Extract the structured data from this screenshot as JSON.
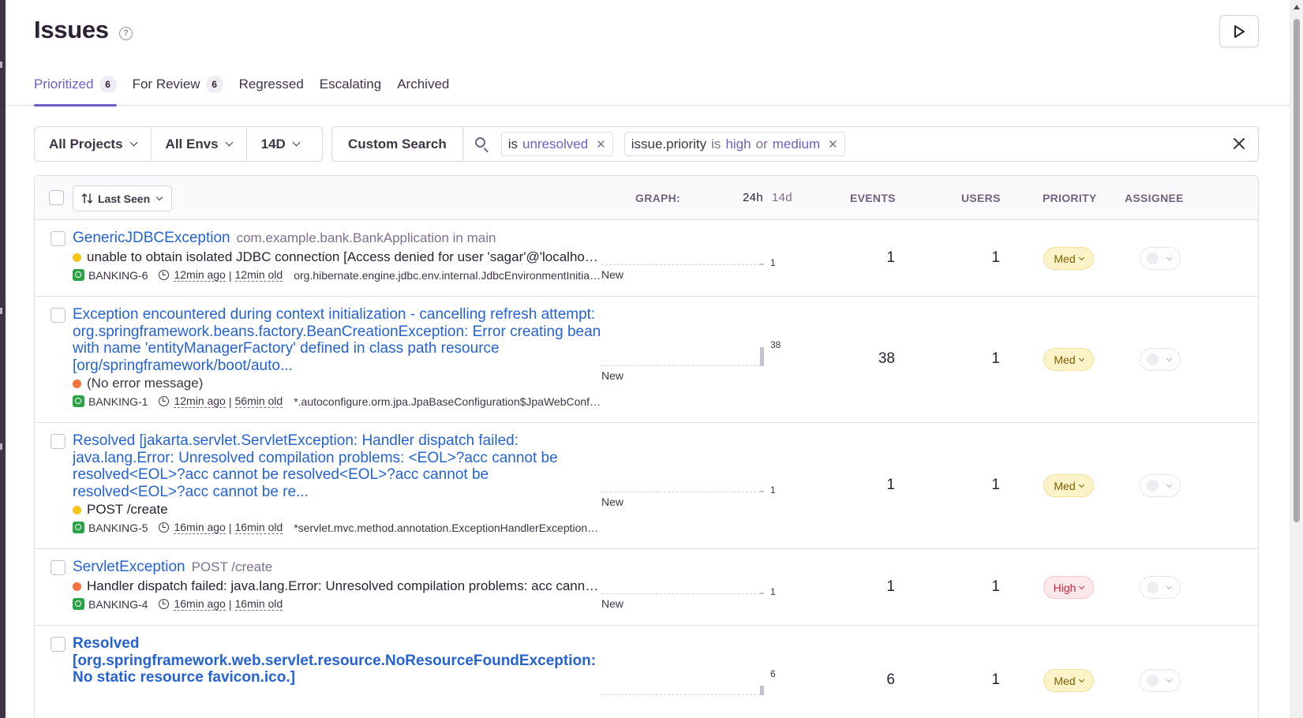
{
  "header": {
    "title": "Issues",
    "help_icon": "question-circle-icon",
    "play_icon": "play-icon"
  },
  "tabs": [
    {
      "label": "Prioritized",
      "count": "6",
      "active": true
    },
    {
      "label": "For Review",
      "count": "6",
      "active": false
    },
    {
      "label": "Regressed",
      "count": null,
      "active": false
    },
    {
      "label": "Escalating",
      "count": null,
      "active": false
    },
    {
      "label": "Archived",
      "count": null,
      "active": false
    }
  ],
  "filters": {
    "projects": "All Projects",
    "envs": "All Envs",
    "period": "14D"
  },
  "search": {
    "custom_search_label": "Custom Search",
    "tokens": [
      {
        "key": "",
        "op": "is",
        "value": "unresolved",
        "extra": ""
      },
      {
        "key": "issue.priority",
        "op": "is",
        "value": "high",
        "sep": "or",
        "value2": "medium"
      }
    ]
  },
  "table": {
    "sort_label": "Last Seen",
    "columns": {
      "graph": "GRAPH:",
      "graph_24h": "24h",
      "graph_14d": "14d",
      "events": "EVENTS",
      "users": "USERS",
      "priority": "PRIORITY",
      "assignee": "ASSIGNEE"
    },
    "rows": [
      {
        "title": "GenericJDBCException",
        "culprit": "com.example.bank.BankApplication in main",
        "message": "unable to obtain isolated JDBC connection [Access denied for user 'sagar'@'localhost' (using password: YES)]",
        "level_color": "#f5c51a",
        "project": "BANKING-6",
        "last_seen": "12min ago",
        "age": "12min old",
        "location": "org.hibernate.engine.jdbc.env.internal.JdbcEnvironmentInitiator in getJdbcEnvironmentUsingJdbcMetadata",
        "spark_value": "1",
        "spark_level": 0.03,
        "new_label": "New",
        "events": "1",
        "users": "1",
        "priority": "Med"
      },
      {
        "title": "Exception encountered during context initialization - cancelling refresh attempt: org.springframework.beans.factory.BeanCreationException: Error creating bean with name 'entityManagerFactory' defined in class path resource [org/springframework/boot/auto...",
        "culprit": "",
        "message": "(No error message)",
        "level_color": "#f2733d",
        "project": "BANKING-1",
        "last_seen": "12min ago",
        "age": "56min old",
        "location": "*.autoconfigure.orm.jpa.JpaBaseConfiguration$JpaWebConfiguration in openEntityManagerInViewInterceptor",
        "spark_value": "38",
        "spark_level": 1,
        "new_label": "New",
        "events": "38",
        "users": "1",
        "priority": "Med"
      },
      {
        "title": "Resolved [jakarta.servlet.ServletException: Handler dispatch failed: java.lang.Error: Unresolved compilation problems: <EOL>?acc cannot be resolved<EOL>?acc cannot be resolved<EOL>?acc cannot be resolved<EOL>?acc cannot be re...",
        "culprit": "",
        "message": "POST /create",
        "level_color": "#f5c51a",
        "project": "BANKING-5",
        "last_seen": "16min ago",
        "age": "16min old",
        "location": "*servlet.mvc.method.annotation.ExceptionHandlerExceptionResolver in logException",
        "spark_value": "1",
        "spark_level": 0.03,
        "new_label": "New",
        "events": "1",
        "users": "1",
        "priority": "Med"
      },
      {
        "title": "ServletException",
        "culprit": "POST /create",
        "message": "Handler dispatch failed: java.lang.Error: Unresolved compilation problems: acc cannot be resolved",
        "level_color": "#f2733d",
        "project": "BANKING-4",
        "last_seen": "16min ago",
        "age": "16min old",
        "location": "",
        "spark_value": "1",
        "spark_level": 0.03,
        "new_label": "New",
        "events": "1",
        "users": "1",
        "priority": "High"
      },
      {
        "title": "Resolved [org.springframework.web.servlet.resource.NoResourceFoundException: No static resource favicon.ico.]",
        "culprit": "",
        "message": "",
        "level_color": "",
        "project": "",
        "last_seen": "",
        "age": "",
        "location": "",
        "spark_value": "6",
        "spark_level": 0.5,
        "new_label": "",
        "events": "6",
        "users": "1",
        "priority": "Med"
      }
    ]
  }
}
